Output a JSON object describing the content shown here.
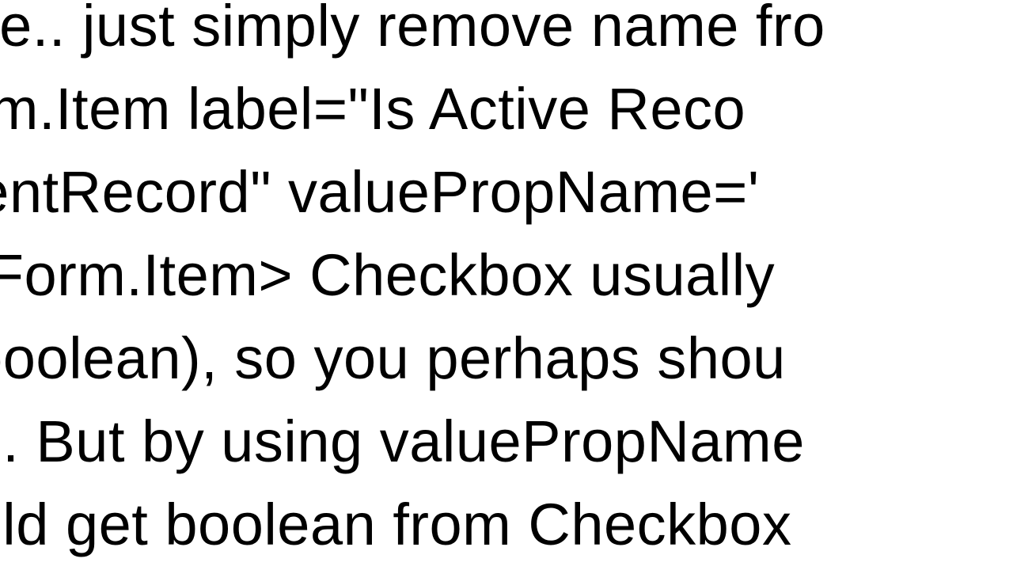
{
  "text": {
    "line1": "ybe.. just simply remove name fro",
    "line2": "orm.Item   label=\"Is Active Reco",
    "line3": "rrentRecord\"   valuePropName='",
    "line4": " </Form.Item>  Checkbox usually",
    "line5": "t boolean), so you perhaps shou",
    "line6": "ad. But by using valuePropName",
    "line7": "ould get boolean from Checkbox"
  }
}
